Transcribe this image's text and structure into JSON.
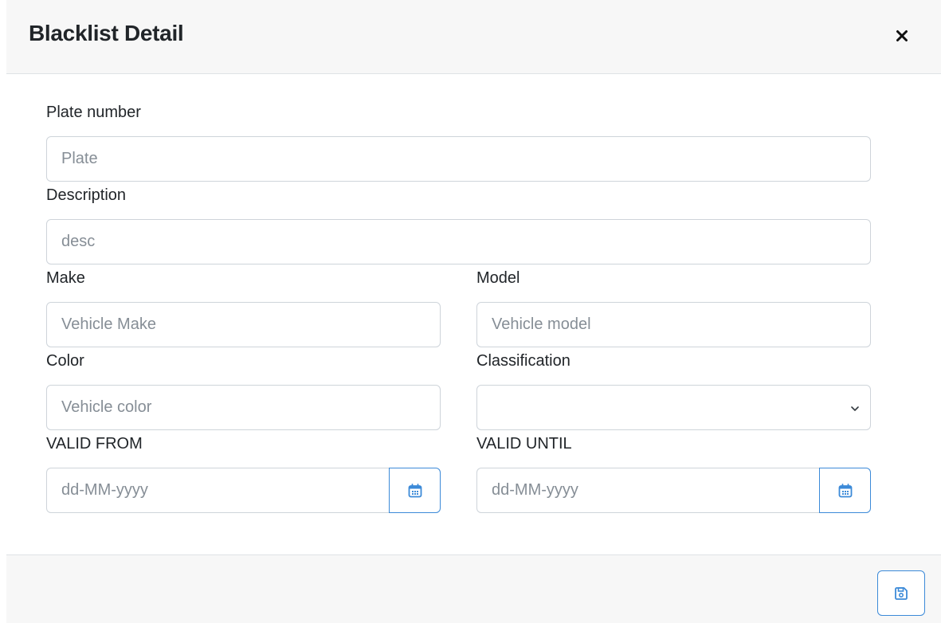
{
  "modal": {
    "title": "Blacklist Detail",
    "close_icon": "close-icon"
  },
  "form": {
    "plate": {
      "label": "Plate number",
      "placeholder": "Plate",
      "value": ""
    },
    "description": {
      "label": "Description",
      "placeholder": "desc",
      "value": ""
    },
    "make": {
      "label": "Make",
      "placeholder": "Vehicle Make",
      "value": ""
    },
    "model": {
      "label": "Model",
      "placeholder": "Vehicle model",
      "value": ""
    },
    "color": {
      "label": "Color",
      "placeholder": "Vehicle color",
      "value": ""
    },
    "classification": {
      "label": "Classification",
      "selected": ""
    },
    "valid_from": {
      "label": "VALID FROM",
      "placeholder": "dd-MM-yyyy",
      "icon": "calendar-icon"
    },
    "valid_until": {
      "label": "VALID UNTIL",
      "placeholder": "dd-MM-yyyy",
      "icon": "calendar-icon"
    }
  },
  "footer": {
    "save_icon": "save-icon"
  },
  "colors": {
    "accent": "#3c8ad8",
    "header_bg": "#f7f7f7",
    "border": "#ced4da",
    "placeholder": "#868e96"
  }
}
